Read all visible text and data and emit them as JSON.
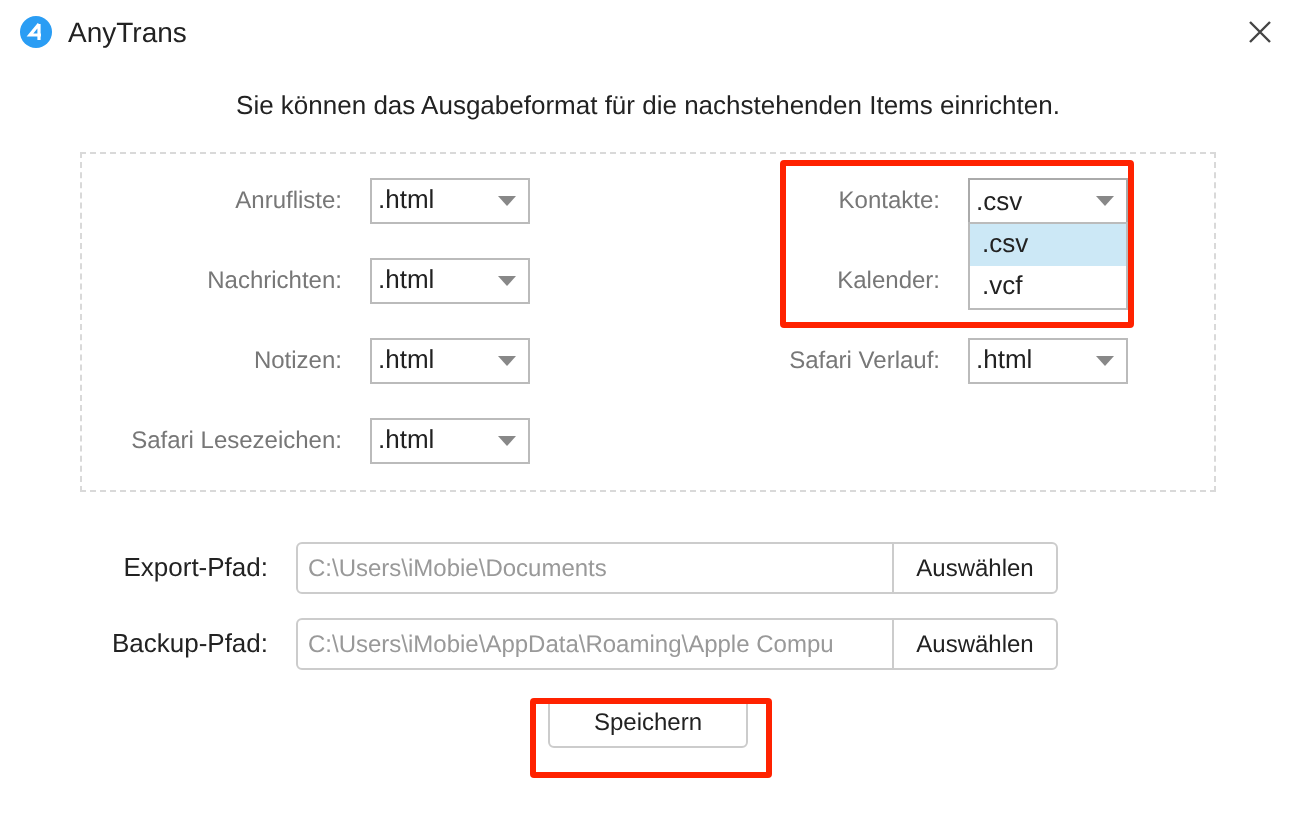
{
  "window": {
    "title": "AnyTrans"
  },
  "intro": "Sie können das Ausgabeformat für die nachstehenden Items einrichten.",
  "left_fields": [
    {
      "label": "Anrufliste:",
      "value": ".html"
    },
    {
      "label": "Nachrichten:",
      "value": ".html"
    },
    {
      "label": "Notizen:",
      "value": ".html"
    },
    {
      "label": "Safari Lesezeichen:",
      "value": ".html"
    }
  ],
  "right_fields": [
    {
      "label": "Kontakte:",
      "value": ".csv",
      "expanded": true,
      "highlighted": true,
      "options": [
        {
          "label": ".csv",
          "selected": true
        },
        {
          "label": ".vcf",
          "selected": false
        }
      ]
    },
    {
      "label": "Kalender:"
    },
    {
      "label": "Safari Verlauf:",
      "value": ".html"
    }
  ],
  "paths": [
    {
      "label": "Export-Pfad:",
      "value": "C:\\Users\\iMobie\\Documents",
      "button": "Auswählen"
    },
    {
      "label": "Backup-Pfad:",
      "value": "C:\\Users\\iMobie\\AppData\\Roaming\\Apple Compu",
      "button": "Auswählen"
    }
  ],
  "save_button": {
    "label": "Speichern",
    "highlighted": true
  }
}
